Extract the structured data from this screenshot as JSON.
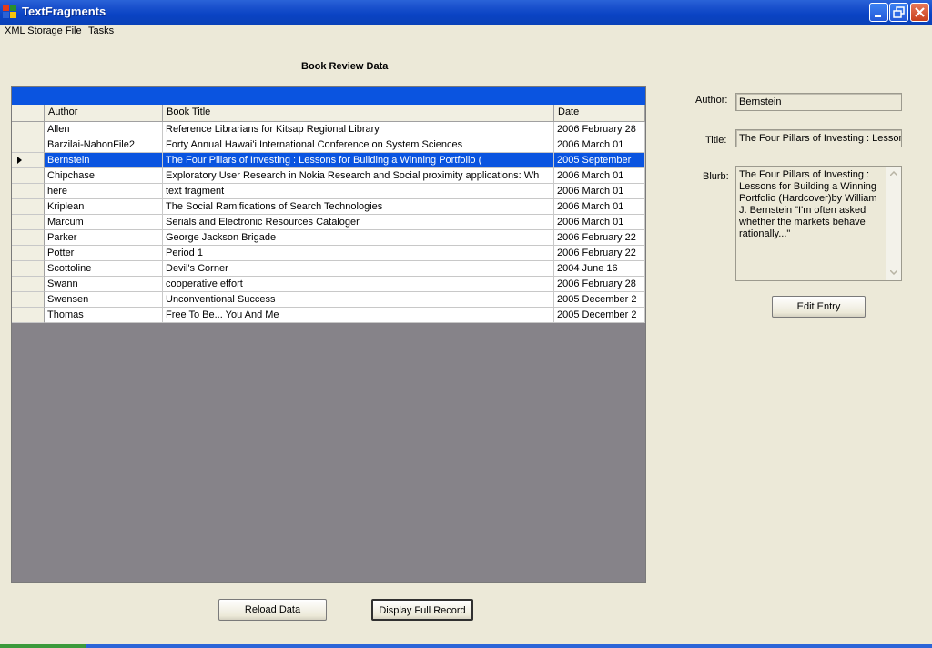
{
  "window": {
    "title": "TextFragments"
  },
  "menu": [
    "XML Storage File",
    "Tasks"
  ],
  "heading": "Book Review Data",
  "grid": {
    "columns": [
      "Author",
      "Book Title",
      "Date"
    ],
    "selected_index": 2,
    "rows": [
      {
        "author": "Allen",
        "title": "Reference Librarians for Kitsap Regional Library",
        "date": "2006  February 28"
      },
      {
        "author": "Barzilai-NahonFile2",
        "title": "Forty Annual Hawai'i International Conference on System Sciences",
        "date": "2006  March 01"
      },
      {
        "author": "Bernstein",
        "title": "The Four Pillars of Investing : Lessons for Building a Winning Portfolio (",
        "date": "2005  September"
      },
      {
        "author": "Chipchase",
        "title": "Exploratory User Research in Nokia Research and Social proximity applications: Wh",
        "date": "2006  March 01"
      },
      {
        "author": "here",
        "title": "text fragment",
        "date": "2006  March 01"
      },
      {
        "author": "Kriplean",
        "title": "The Social Ramifications of Search Technologies",
        "date": "2006  March 01"
      },
      {
        "author": "Marcum",
        "title": "Serials and Electronic Resources Cataloger",
        "date": "2006  March 01"
      },
      {
        "author": "Parker",
        "title": "George Jackson Brigade",
        "date": "2006  February 22"
      },
      {
        "author": "Potter",
        "title": "Period 1",
        "date": "2006  February 22"
      },
      {
        "author": "Scottoline",
        "title": "Devil's Corner",
        "date": "2004  June 16"
      },
      {
        "author": "Swann",
        "title": "cooperative effort",
        "date": "2006  February 28"
      },
      {
        "author": "Swensen",
        "title": "Unconventional Success",
        "date": "2005  December 2"
      },
      {
        "author": "Thomas",
        "title": "Free To Be... You And Me",
        "date": "2005  December 2"
      }
    ]
  },
  "detail": {
    "author_label": "Author:",
    "author_value": "Bernstein",
    "title_label": "Title:",
    "title_value": "The Four Pillars of Investing : Lessons",
    "blurb_label": "Blurb:",
    "blurb_value": "The Four Pillars of Investing : Lessons for Building a Winning Portfolio (Hardcover)by William J. Bernstein \"I'm often asked whether the markets behave rationally...\""
  },
  "buttons": {
    "edit": "Edit Entry",
    "reload": "Reload Data",
    "display": "Display Full Record"
  },
  "colors": {
    "titlebar": "#0a43c4",
    "selection": "#0a54e0",
    "grid_bg": "#868389",
    "window_bg": "#ece9d8"
  }
}
